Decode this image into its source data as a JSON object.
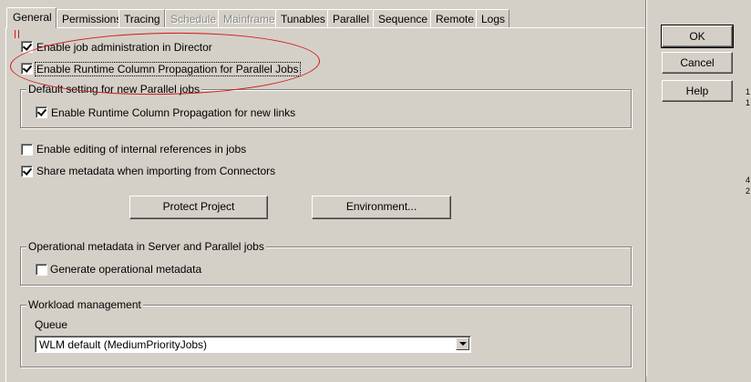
{
  "tabs": [
    {
      "label": "General",
      "active": true,
      "disabled": false
    },
    {
      "label": "Permissions",
      "active": false,
      "disabled": false
    },
    {
      "label": "Tracing",
      "active": false,
      "disabled": false
    },
    {
      "label": "Schedule",
      "active": false,
      "disabled": true
    },
    {
      "label": "Mainframe",
      "active": false,
      "disabled": true
    },
    {
      "label": "Tunables",
      "active": false,
      "disabled": false
    },
    {
      "label": "Parallel",
      "active": false,
      "disabled": false
    },
    {
      "label": "Sequence",
      "active": false,
      "disabled": false
    },
    {
      "label": "Remote",
      "active": false,
      "disabled": false
    },
    {
      "label": "Logs",
      "active": false,
      "disabled": false
    }
  ],
  "options": {
    "job_admin": {
      "label": "Enable job administration in Director",
      "checked": true
    },
    "rcp_parallel": {
      "label": "Enable Runtime Column Propagation for Parallel Jobs",
      "checked": true
    },
    "internal_refs": {
      "label": "Enable editing of internal references in jobs",
      "checked": false
    },
    "share_metadata": {
      "label": "Share metadata when importing from Connectors",
      "checked": true
    }
  },
  "default_parallel_group": {
    "title": "Default setting for new Parallel jobs",
    "rcp_links": {
      "label": "Enable Runtime Column Propagation for new links",
      "checked": true
    }
  },
  "buttons": {
    "protect_project": "Protect Project",
    "environment": "Environment...",
    "ok": "OK",
    "cancel": "Cancel",
    "help": "Help"
  },
  "operational_group": {
    "title": "Operational metadata in Server and Parallel jobs",
    "generate": {
      "label": "Generate operational metadata",
      "checked": false
    }
  },
  "workload_group": {
    "title": "Workload management",
    "queue_label": "Queue",
    "queue_value": "WLM default (MediumPriorityJobs)"
  },
  "annotation_color": "#d01818",
  "edge_fragments": [
    "1",
    "1",
    "4",
    "2"
  ]
}
